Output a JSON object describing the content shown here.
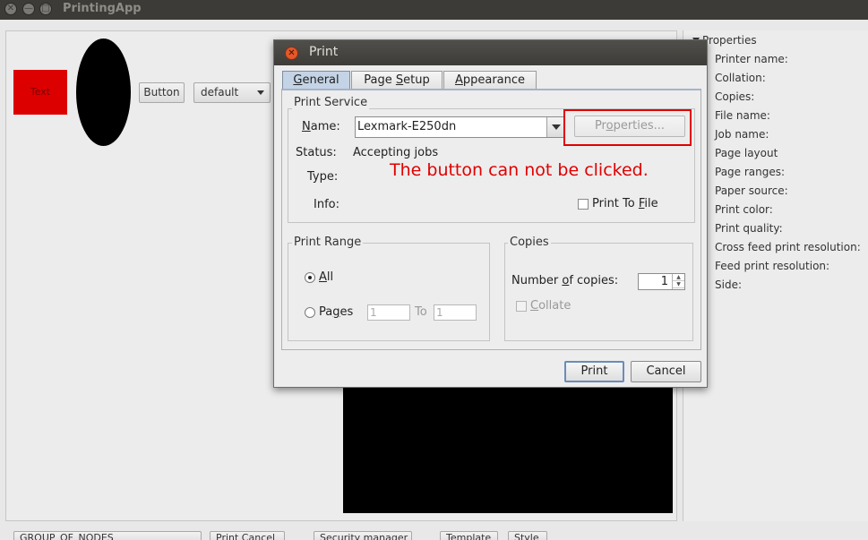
{
  "app": {
    "title": "PrintingApp",
    "close_glyph": "✕",
    "minimize_glyph": "—",
    "maximize_glyph": "□"
  },
  "canvas": {
    "text_node": "Text",
    "button_label": "Button",
    "combo_value": "default"
  },
  "properties_panel": {
    "header": "Properties",
    "items": [
      "Printer name:",
      "Collation:",
      "Copies:",
      "File name:",
      "Job name:",
      "Page layout",
      "Page ranges:",
      "Paper source:",
      "Print color:",
      "Print quality:",
      "Cross feed print resolution:",
      "Feed print resolution:",
      "Side:"
    ]
  },
  "bottom_toolbar": {
    "buttons": [
      "GROUP_OF_NODES",
      "Print Cancel",
      "Security manager",
      "Template",
      "Style"
    ]
  },
  "dialog": {
    "title": "Print",
    "close_glyph": "✕",
    "tabs": [
      {
        "pre": "",
        "key": "G",
        "post": "eneral"
      },
      {
        "pre": "Page ",
        "key": "S",
        "post": "etup"
      },
      {
        "pre": "",
        "key": "A",
        "post": "ppearance"
      }
    ],
    "print_service": {
      "title": "Print Service",
      "name_label_key": "N",
      "name_label_rest": "ame:",
      "name_value": "Lexmark-E250dn",
      "properties_pre": "Pr",
      "properties_key": "o",
      "properties_post": "perties...",
      "status_label": "Status:",
      "status_value": "Accepting jobs",
      "type_label": "Type:",
      "info_label": "Info:",
      "print_to_file_pre": "Print To ",
      "print_to_file_key": "F",
      "print_to_file_post": "ile"
    },
    "annotation": "The button can not be clicked.",
    "print_range": {
      "title": "Print Range",
      "all_key": "A",
      "all_rest": "ll",
      "pages_pre": "Pa",
      "pages_key": "g",
      "pages_post": "es",
      "from_value": "1",
      "to_label": "To",
      "to_value": "1"
    },
    "copies": {
      "title": "Copies",
      "number_pre": "Number ",
      "number_key": "o",
      "number_post": "f copies:",
      "value": "1",
      "collate_key": "C",
      "collate_rest": "ollate"
    },
    "print_button": "Print",
    "cancel_button": "Cancel"
  }
}
